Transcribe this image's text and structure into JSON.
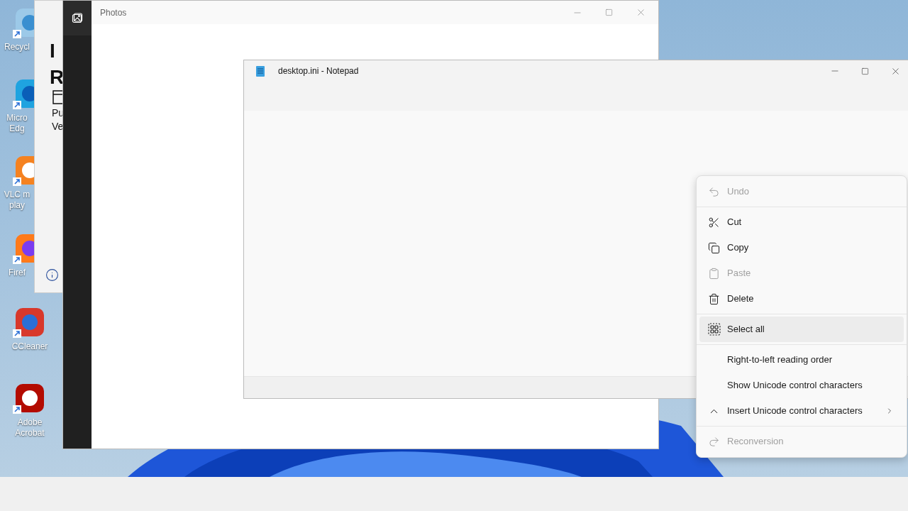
{
  "desktop_icons": [
    {
      "label_lines": [
        "Recycl"
      ]
    },
    {
      "label_lines": [
        "Micro",
        "Edg"
      ]
    },
    {
      "label_lines": [
        "VLC m",
        "play"
      ]
    },
    {
      "label_lines": [
        "Firef"
      ]
    },
    {
      "label_lines": [
        "CCleaner"
      ]
    },
    {
      "label_lines": [
        "Adobe",
        "Acrobat"
      ]
    }
  ],
  "back_window": {
    "heading_lines": [
      "I",
      "R"
    ],
    "text_lines": [
      "Pu",
      "Ve"
    ]
  },
  "photos_window": {
    "title": "Photos"
  },
  "notepad_window": {
    "title": "desktop.ini - Notepad"
  },
  "context_menu": {
    "items": [
      {
        "kind": "item",
        "label": "Undo",
        "disabled": true,
        "selected": false
      },
      {
        "kind": "separator"
      },
      {
        "kind": "item",
        "label": "Cut",
        "disabled": false,
        "selected": false
      },
      {
        "kind": "item",
        "label": "Copy",
        "disabled": false,
        "selected": false
      },
      {
        "kind": "item",
        "label": "Paste",
        "disabled": true,
        "selected": false
      },
      {
        "kind": "item",
        "label": "Delete",
        "disabled": false,
        "selected": false
      },
      {
        "kind": "separator"
      },
      {
        "kind": "item",
        "label": "Select all",
        "disabled": false,
        "selected": true
      },
      {
        "kind": "separator"
      },
      {
        "kind": "item",
        "label": "Right-to-left reading order",
        "disabled": false,
        "selected": false
      },
      {
        "kind": "item",
        "label": "Show Unicode control characters",
        "disabled": false,
        "selected": false
      },
      {
        "kind": "item",
        "label": "Insert Unicode control characters",
        "disabled": false,
        "selected": false,
        "submenu": true
      },
      {
        "kind": "separator"
      },
      {
        "kind": "item",
        "label": "Reconversion",
        "disabled": true,
        "selected": false
      }
    ]
  }
}
